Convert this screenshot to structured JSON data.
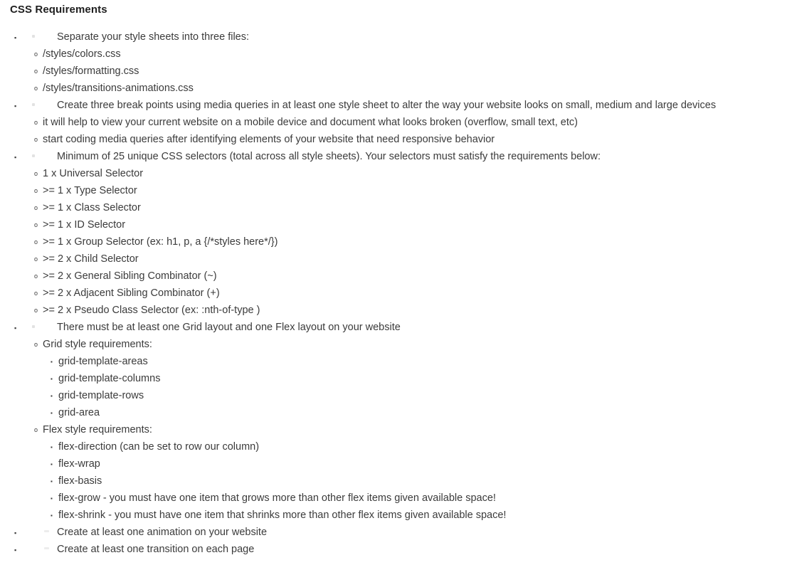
{
  "document": {
    "title": "CSS Requirements",
    "colors": {
      "background": "#ffffff",
      "heading_text": "#1f1f1f",
      "body_text": "#3b3b3b"
    },
    "markers": {
      "level1": "▪",
      "level2": "o",
      "level3": "▪"
    },
    "items": [
      {
        "level": 1,
        "text": "Separate your style sheets into three files:"
      },
      {
        "level": 2,
        "text": "/styles/colors.css"
      },
      {
        "level": 2,
        "text": "/styles/formatting.css"
      },
      {
        "level": 2,
        "text": "/styles/transitions-animations.css"
      },
      {
        "level": 1,
        "text": "Create three break points using media queries in at least one style sheet to alter the way your website looks on small, medium and large devices"
      },
      {
        "level": 2,
        "text": "it will help to view your current website on a mobile device and document what looks broken (overflow, small text, etc)"
      },
      {
        "level": 2,
        "text": "start coding media queries after identifying elements of your website that need responsive behavior"
      },
      {
        "level": 1,
        "text": "Minimum of 25 unique CSS selectors (total across all style sheets). Your selectors must satisfy the requirements below:"
      },
      {
        "level": 2,
        "text": "1 x Universal Selector"
      },
      {
        "level": 2,
        "text": ">= 1 x Type Selector"
      },
      {
        "level": 2,
        "text": ">= 1 x Class Selector"
      },
      {
        "level": 2,
        "text": ">= 1 x ID Selector"
      },
      {
        "level": 2,
        "text": ">= 1 x Group Selector (ex: h1, p, a {/*styles here*/})"
      },
      {
        "level": 2,
        "text": ">= 2 x Child Selector"
      },
      {
        "level": 2,
        "text": ">= 2 x General Sibling Combinator (~)"
      },
      {
        "level": 2,
        "text": ">= 2 x Adjacent Sibling Combinator (+)"
      },
      {
        "level": 2,
        "text": ">= 2 x Pseudo Class Selector (ex: :nth-of-type )"
      },
      {
        "level": 1,
        "text": "There must be at least one Grid layout and one Flex layout on your website"
      },
      {
        "level": 2,
        "text": "Grid style requirements:"
      },
      {
        "level": 3,
        "text": "grid-template-areas"
      },
      {
        "level": 3,
        "text": "grid-template-columns"
      },
      {
        "level": 3,
        "text": "grid-template-rows"
      },
      {
        "level": 3,
        "text": "grid-area"
      },
      {
        "level": 2,
        "text": "Flex style requirements:"
      },
      {
        "level": 3,
        "text": "flex-direction (can be set to row our column)"
      },
      {
        "level": 3,
        "text": "flex-wrap"
      },
      {
        "level": 3,
        "text": "flex-basis"
      },
      {
        "level": 3,
        "text": "flex-grow - you must have one item that grows more than other flex items given available space!"
      },
      {
        "level": 3,
        "text": "flex-shrink - you must have one item that shrinks more than other flex items given available space!"
      },
      {
        "level": 1,
        "text": "Create at least one animation on your website"
      },
      {
        "level": 1,
        "text": "Create at least one transition on each page"
      }
    ]
  }
}
